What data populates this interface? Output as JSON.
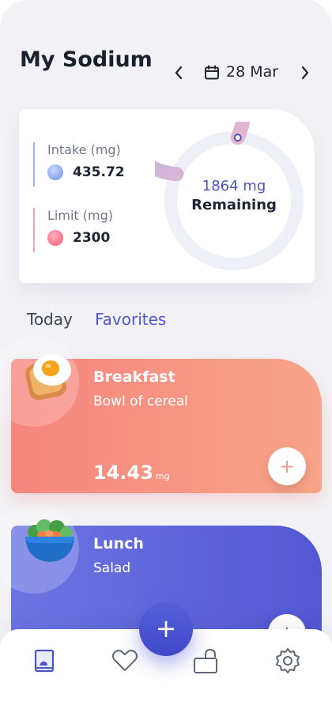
{
  "header": {
    "title": "My Sodium",
    "date": "28 Mar",
    "prev_icon": "chevron-left-icon",
    "next_icon": "chevron-right-icon",
    "calendar_icon": "calendar-icon"
  },
  "summary": {
    "intake_label": "Intake (mg)",
    "intake_value": "435.72",
    "limit_label": "Limit (mg)",
    "limit_value": "2300",
    "remaining_amount": "1864 mg",
    "remaining_label": "Remaining",
    "remaining_fraction": 0.81,
    "colors": {
      "accent": "#4d58c4",
      "ring_start": "#4a55c6",
      "ring_end": "#f6b7c4"
    }
  },
  "tabs": [
    {
      "label": "Today",
      "active": false
    },
    {
      "label": "Favorites",
      "active": true
    }
  ],
  "meals": [
    {
      "name": "Breakfast",
      "description": "Bowl of cereal",
      "amount": "14.43",
      "unit": "mg",
      "icon": "egg-toast-icon",
      "color": "#f6857e"
    },
    {
      "name": "Lunch",
      "description": "Salad",
      "icon": "salad-bowl-icon",
      "color": "#5457d2"
    }
  ],
  "bottom_nav": {
    "items": [
      "journal-icon",
      "heart-icon",
      "unlock-icon",
      "gear-icon"
    ],
    "fab": "+",
    "add_symbol": "+"
  }
}
